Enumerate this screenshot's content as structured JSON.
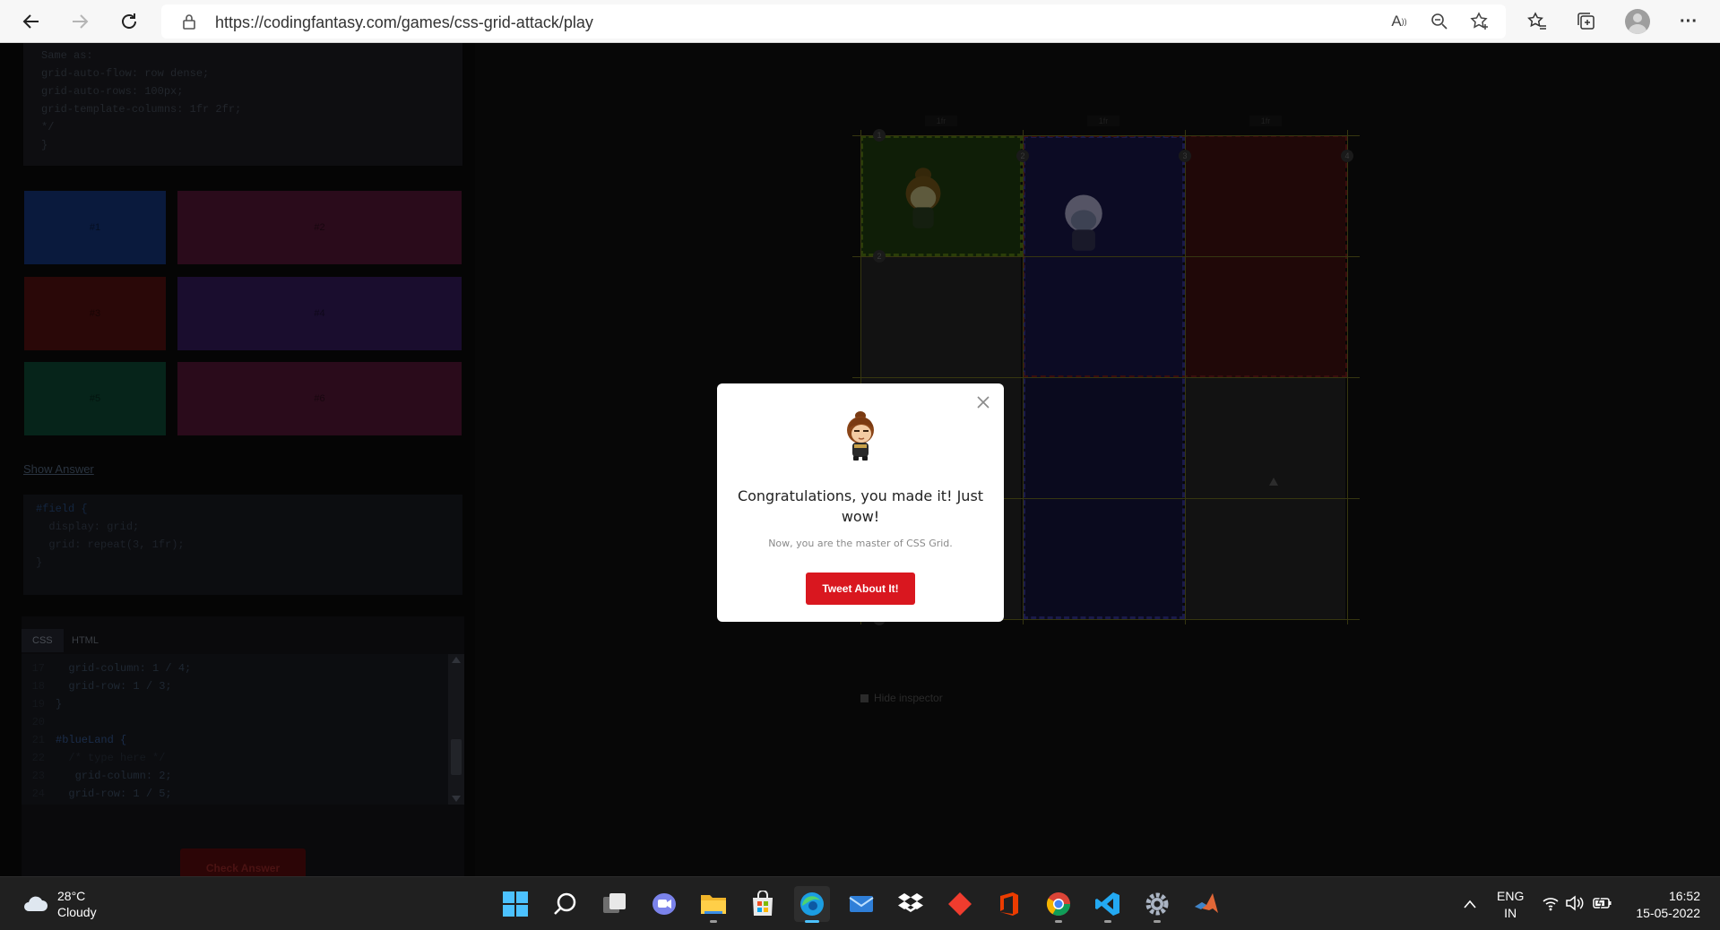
{
  "browser": {
    "url": "https://codingfantasy.com/games/css-grid-attack/play"
  },
  "sidebar": {
    "code_top_lines": [
      "  Same as:",
      "  grid-auto-flow: row dense;",
      "  grid-auto-rows: 100px;",
      "  grid-template-columns: 1fr 2fr;",
      "*/",
      "}"
    ],
    "preview_labels": [
      "#1",
      "#2",
      "#3",
      "#4",
      "#5",
      "#6"
    ],
    "show_answer": "Show Answer",
    "answer_lines": [
      "#field {",
      "  display: grid;",
      "  grid: repeat(3, 1fr);",
      "}"
    ],
    "tabs": [
      "CSS",
      "HTML"
    ],
    "editor_lines": [
      {
        "n": "17",
        "code": "  grid-column: 1 / 4;"
      },
      {
        "n": "18",
        "code": "  grid-row: 1 / 3;"
      },
      {
        "n": "19",
        "code": "}"
      },
      {
        "n": "20",
        "code": ""
      },
      {
        "n": "21",
        "code": "#blueLand {"
      },
      {
        "n": "22",
        "code": "  /* type here */"
      },
      {
        "n": "23",
        "code": "   grid-column: 2;"
      },
      {
        "n": "24",
        "code": "  grid-row: 1 / 5;"
      }
    ],
    "check_answer": "Check Answer"
  },
  "board": {
    "col_labels": [
      "1fr",
      "1fr",
      "1fr"
    ],
    "line_numbers": [
      "1",
      "2",
      "3",
      "4",
      "2",
      "5"
    ],
    "hide_inspector": "Hide inspector"
  },
  "modal": {
    "title": "Congratulations, you made it! Just wow!",
    "subtitle": "Now, you are the master of CSS Grid.",
    "tweet_button": "Tweet About It!"
  },
  "taskbar": {
    "weather_temp": "28°C",
    "weather_desc": "Cloudy",
    "lang_top": "ENG",
    "lang_bottom": "IN",
    "time": "16:52",
    "date": "15-05-2022",
    "apps": [
      "start-icon",
      "search-icon",
      "task-view-icon",
      "teams-chat-icon",
      "file-explorer-icon",
      "microsoft-store-icon",
      "edge-icon",
      "mail-icon",
      "dropbox-icon",
      "git-icon",
      "office-icon",
      "chrome-icon",
      "vscode-icon",
      "settings-icon",
      "matlab-icon"
    ]
  }
}
